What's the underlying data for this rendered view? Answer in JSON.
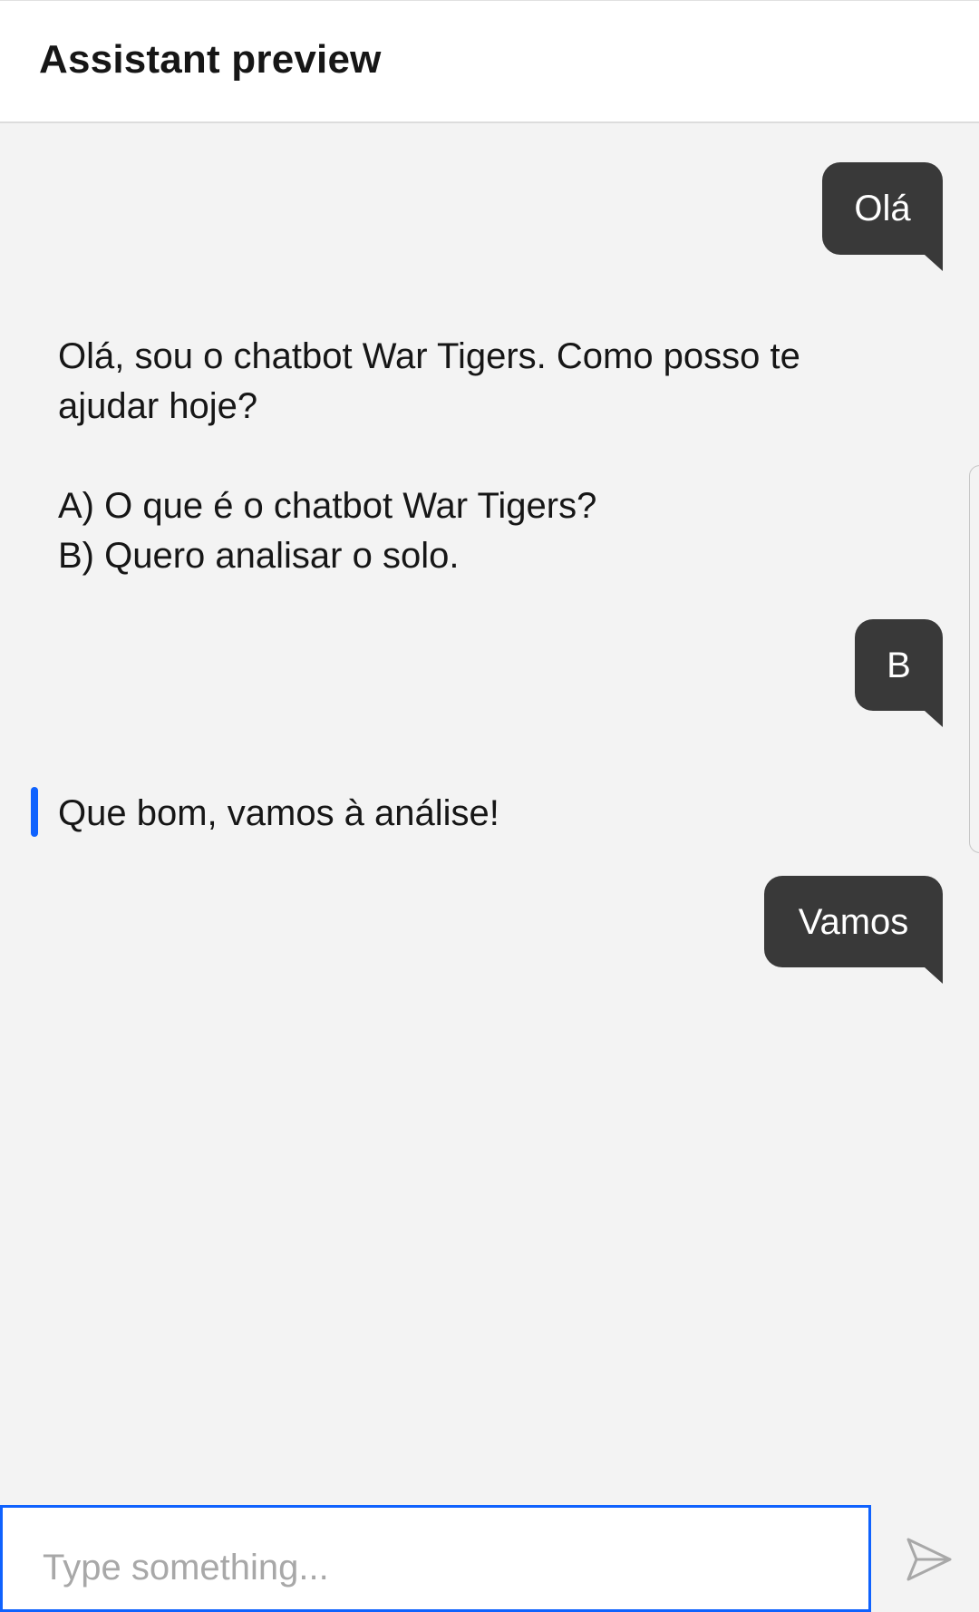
{
  "header": {
    "title": "Assistant preview"
  },
  "conversation": {
    "user_msg_1": "Olá",
    "bot_msg_1": "Olá, sou o chatbot War Tigers. Como posso te ajudar hoje?\n\nA) O que é o chatbot War Tigers?\nB) Quero analisar o solo.",
    "user_msg_2": "B",
    "bot_msg_2": "Que bom, vamos à análise!",
    "user_msg_3": "Vamos"
  },
  "composer": {
    "placeholder": "Type something...",
    "value": "",
    "send_icon": "send-icon"
  },
  "colors": {
    "accent": "#0f62fe",
    "user_bubble": "#393939",
    "background": "#f3f3f3",
    "header_bg": "#ffffff",
    "text": "#161616",
    "placeholder": "#a8a8a8"
  }
}
